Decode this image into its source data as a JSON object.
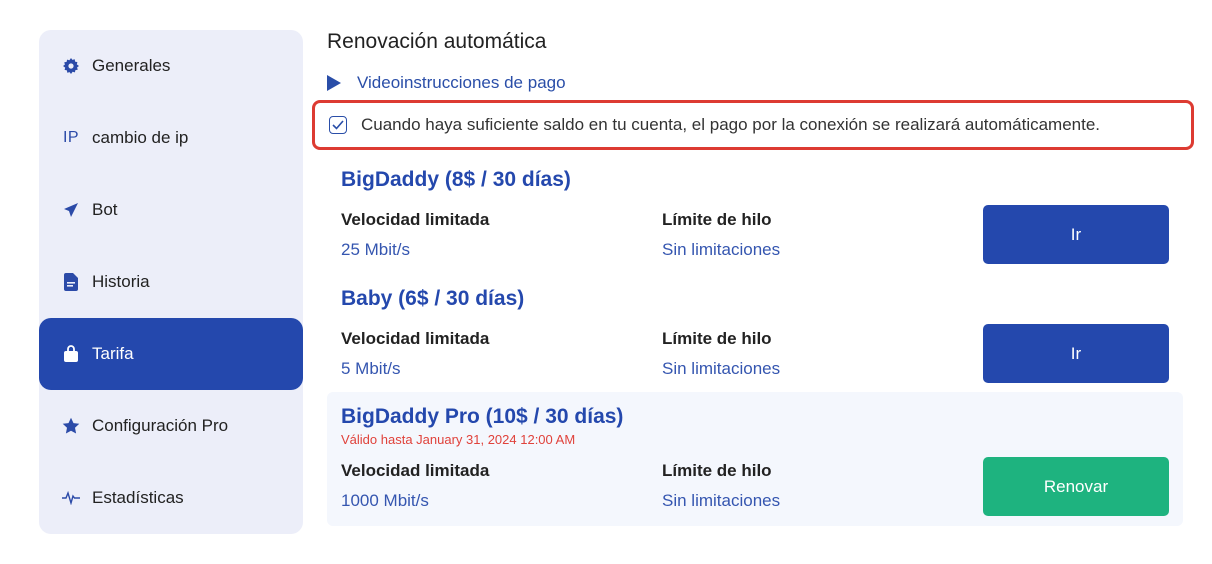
{
  "sidebar": {
    "items": [
      {
        "label": "Generales",
        "icon": "gear-icon"
      },
      {
        "label": "cambio de ip",
        "icon": "ip-icon",
        "icon_text": "IP"
      },
      {
        "label": "Bot",
        "icon": "send-icon"
      },
      {
        "label": "Historia",
        "icon": "document-icon"
      },
      {
        "label": "Tarifa",
        "icon": "shopping-bag-icon",
        "active": true
      },
      {
        "label": "Configuración Pro",
        "icon": "star-icon"
      },
      {
        "label": "Estadísticas",
        "icon": "pulse-icon"
      }
    ]
  },
  "main": {
    "title": "Renovación automática",
    "video_link": "Videoinstrucciones de pago",
    "auto_renew": {
      "checked": true,
      "text": "Cuando haya suficiente saldo en tu cuenta, el pago por la conexión se realizará automáticamente."
    },
    "plans": [
      {
        "name": "BigDaddy (8$ / 30 días)",
        "speed_label": "Velocidad limitada",
        "speed_value": "25 Mbit/s",
        "thread_label": "Límite de hilo",
        "thread_value": "Sin limitaciones",
        "button": "Ir"
      },
      {
        "name": "Baby (6$ / 30 días)",
        "speed_label": "Velocidad limitada",
        "speed_value": "5 Mbit/s",
        "thread_label": "Límite de hilo",
        "thread_value": "Sin limitaciones",
        "button": "Ir"
      },
      {
        "name": "BigDaddy Pro (10$ / 30 días)",
        "valid_until": "Válido hasta January 31, 2024 12:00 AM",
        "speed_label": "Velocidad limitada",
        "speed_value": "1000 Mbit/s",
        "thread_label": "Límite de hilo",
        "thread_value": "Sin limitaciones",
        "button": "Renovar"
      }
    ]
  },
  "colors": {
    "accent": "#2448ad",
    "renew_button": "#1eb37f",
    "highlight_border": "#dd3b32",
    "valid_text": "#e0423b"
  }
}
